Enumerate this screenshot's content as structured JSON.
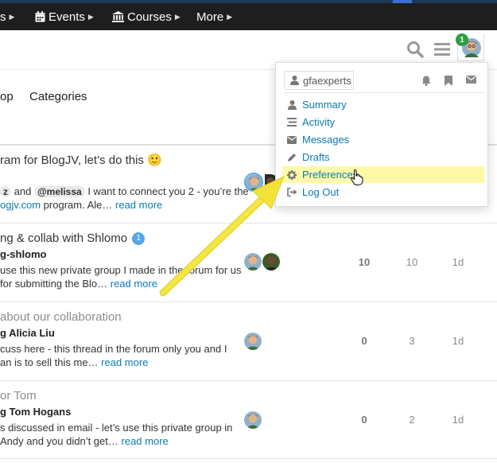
{
  "nav": {
    "items": [
      {
        "label": "s"
      },
      {
        "label": "Events",
        "icon": "calendar-icon"
      },
      {
        "label": "Courses",
        "icon": "university-icon"
      },
      {
        "label": "More"
      }
    ]
  },
  "header": {
    "notification_count": "1",
    "icons": [
      "search-icon",
      "hamburger-icon",
      "avatar"
    ]
  },
  "tabs": [
    "op",
    "Categories"
  ],
  "user_menu": {
    "username": "gfaexperts",
    "top_icons": [
      "bell-icon",
      "bookmark-icon",
      "envelope-icon"
    ],
    "items": [
      {
        "label": "Summary",
        "icon": "user-icon"
      },
      {
        "label": "Activity",
        "icon": "stream-icon"
      },
      {
        "label": "Messages",
        "icon": "envelope-icon"
      },
      {
        "label": "Drafts",
        "icon": "pencil-icon"
      },
      {
        "label": "Preferences",
        "icon": "cog-icon"
      },
      {
        "label": "Log Out",
        "icon": "sign-out-icon"
      }
    ],
    "active_item": "Preferences"
  },
  "topics": [
    {
      "title": "ram for BlogJV, let’s do this",
      "emoji": "🙂",
      "mention_1": "z",
      "mention_join": "and",
      "mention_2": "@melissa",
      "excerpt_line_1": "I want to connect you 2 - you’re the",
      "excerpt_link_pre": "ogjv.com",
      "excerpt_line_2": " program. Ale…",
      "read_more": "read more"
    },
    {
      "title": "ng & collab with Shlomo",
      "badge": "1",
      "subtitle": "g-shlomo",
      "excerpt_line_1": "use this new private group I made in the forum for us",
      "excerpt_line_2": "for submitting the Blo…",
      "read_more": "read more",
      "replies": "10",
      "views": "10",
      "activity": "1d"
    },
    {
      "title": "about our collaboration",
      "subtitle": "g Alicia Liu",
      "excerpt_line_1": "cuss here - this thread in the forum only you and I",
      "excerpt_line_2": "an is to sell this me…",
      "read_more": "read more",
      "replies": "0",
      "views": "3",
      "activity": "1d"
    },
    {
      "title": "or Tom",
      "subtitle": "g Tom Hogans",
      "excerpt_line_1": "s discussed in email - let’s use this private group in",
      "excerpt_line_2": "Andy and you didn’t get…",
      "read_more": "read more",
      "replies": "0",
      "views": "2",
      "activity": "1d"
    }
  ],
  "colors": {
    "topbar": "#1e1e1e",
    "link": "#0a7ab8",
    "highlight": "#fdf9a8",
    "arrow": "#f2e23a",
    "notification": "#2e9e3e"
  }
}
